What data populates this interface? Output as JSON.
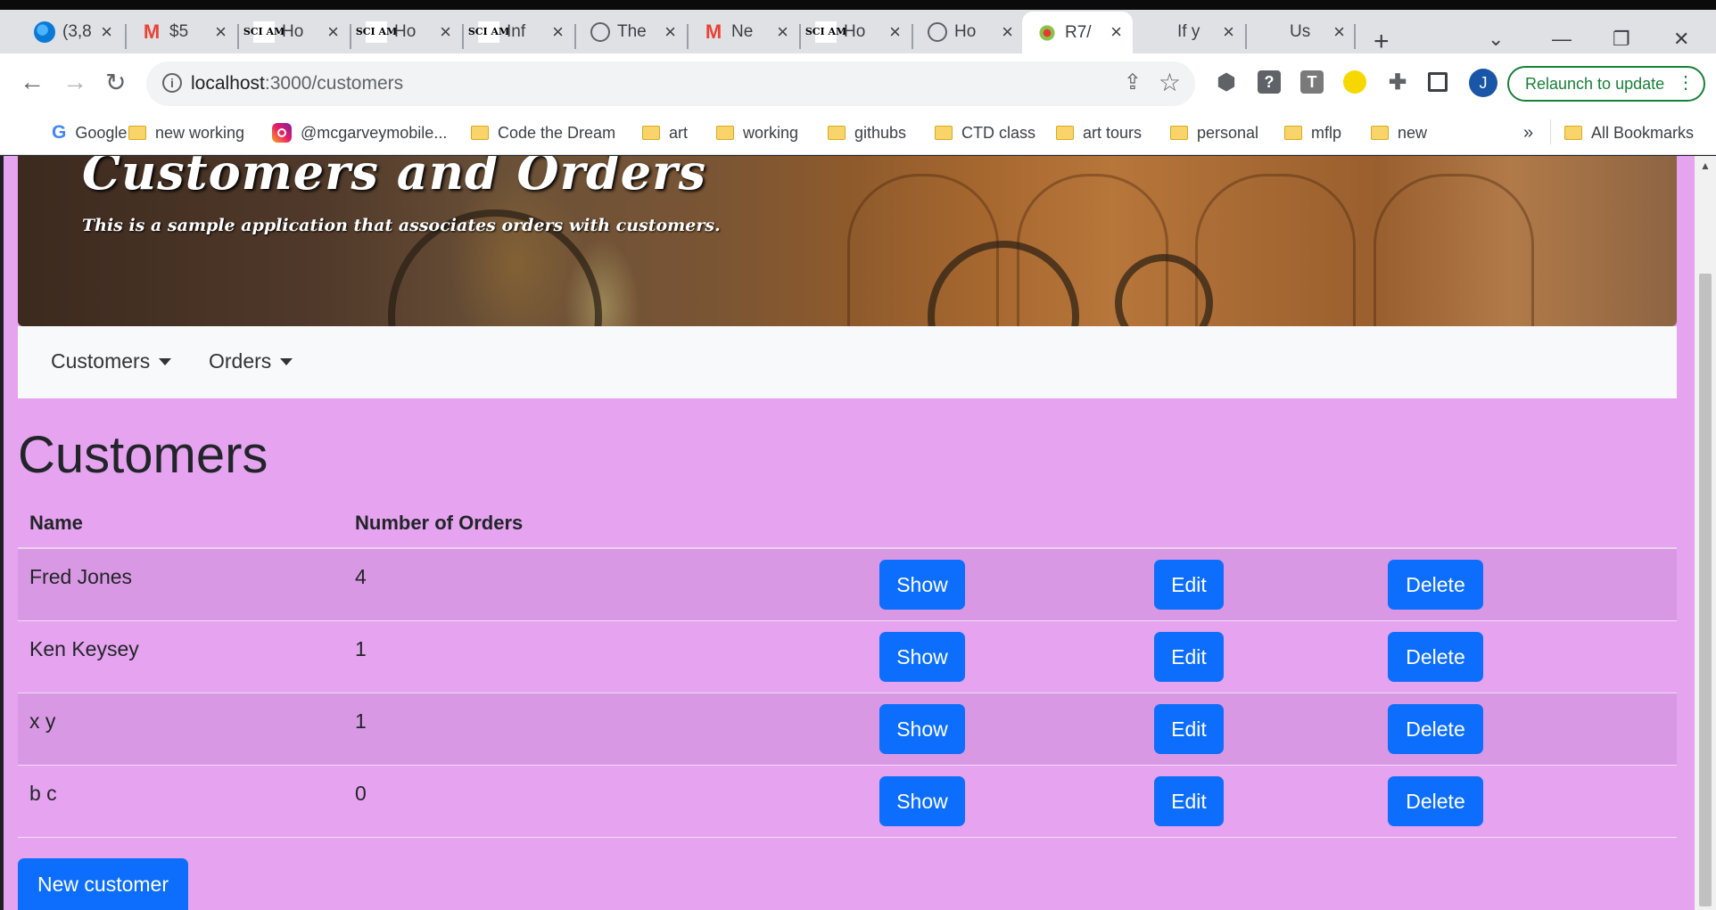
{
  "browser": {
    "tabs": [
      {
        "title": "(3,8",
        "icon": "att-icon"
      },
      {
        "title": "$5",
        "icon": "gmail-icon"
      },
      {
        "title": "Ho",
        "icon": "sciam-icon"
      },
      {
        "title": "Ho",
        "icon": "sciam-icon"
      },
      {
        "title": "Inf",
        "icon": "sciam-icon"
      },
      {
        "title": "The",
        "icon": "round-logo-icon"
      },
      {
        "title": "Ne",
        "icon": "gmail-icon"
      },
      {
        "title": "Ho",
        "icon": "sciam-icon"
      },
      {
        "title": "Ho",
        "icon": "gauge-icon"
      },
      {
        "title": "R7/",
        "icon": "flower-icon",
        "active": true
      },
      {
        "title": "If y",
        "icon": "apple-icon"
      },
      {
        "title": "Us",
        "icon": "apple-icon"
      }
    ],
    "sciam_glyph": "SCI AM",
    "gmail_glyph": "M",
    "url_host": "localhost",
    "url_path": ":3000/customers",
    "relaunch_label": "Relaunch to update",
    "profile_initial": "J",
    "ext_letter": "T",
    "ext_question": "?",
    "bookmarks": [
      {
        "label": "Google",
        "icon": "google-icon"
      },
      {
        "label": "new working",
        "icon": "folder-icon"
      },
      {
        "label": "@mcgarveymobile...",
        "icon": "instagram-icon"
      },
      {
        "label": "Code the Dream",
        "icon": "folder-icon"
      },
      {
        "label": "art",
        "icon": "folder-icon"
      },
      {
        "label": "working",
        "icon": "folder-icon"
      },
      {
        "label": "githubs",
        "icon": "folder-icon"
      },
      {
        "label": "CTD class",
        "icon": "folder-icon"
      },
      {
        "label": "art tours",
        "icon": "folder-icon"
      },
      {
        "label": "personal",
        "icon": "folder-icon"
      },
      {
        "label": "mflp",
        "icon": "folder-icon"
      },
      {
        "label": "new",
        "icon": "folder-icon"
      }
    ],
    "bookmarks_overflow": "»",
    "all_bookmarks": "All Bookmarks"
  },
  "hero": {
    "title": "Customers and Orders",
    "subtitle": "This is a sample application that associates orders with customers."
  },
  "nav": {
    "customers": "Customers",
    "orders": "Orders"
  },
  "page": {
    "title": "Customers",
    "columns": [
      "Name",
      "Number of Orders"
    ],
    "rows": [
      {
        "name": "Fred Jones",
        "orders": "4"
      },
      {
        "name": "Ken Keysey",
        "orders": "1"
      },
      {
        "name": "x y",
        "orders": "1"
      },
      {
        "name": "b c",
        "orders": "0"
      }
    ],
    "show_label": "Show",
    "edit_label": "Edit",
    "delete_label": "Delete",
    "new_customer_label": "New customer"
  },
  "colors": {
    "page_background": "#e6a3ef",
    "striped_row": "#d998e3",
    "button_primary": "#0d6efd",
    "navbar": "#f8f9fa",
    "relaunch_green": "#188038"
  }
}
